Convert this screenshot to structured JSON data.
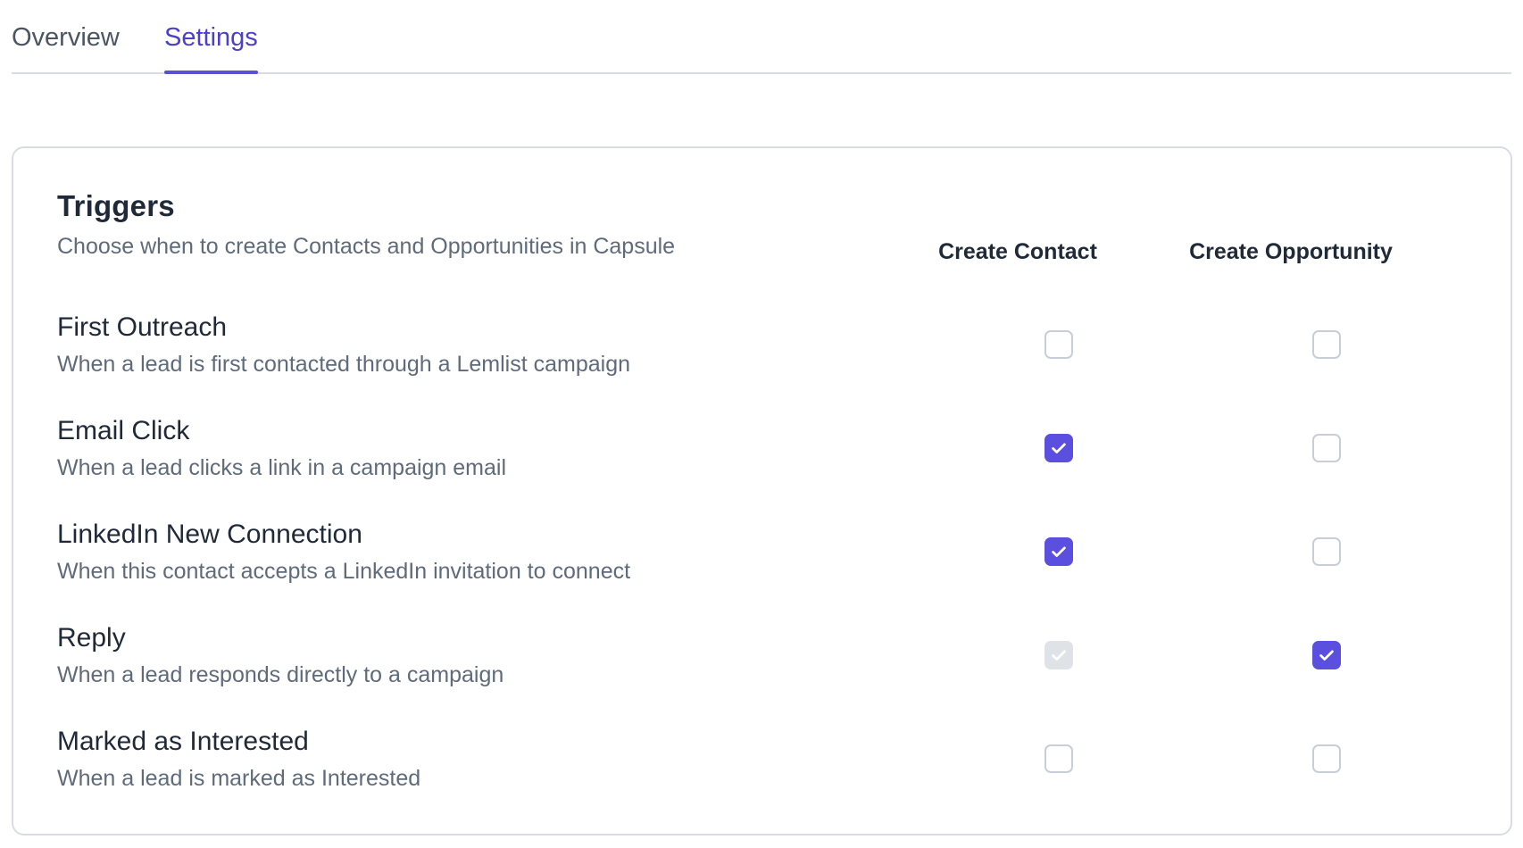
{
  "tabs": [
    {
      "label": "Overview",
      "active": false
    },
    {
      "label": "Settings",
      "active": true
    }
  ],
  "card": {
    "title": "Triggers",
    "subtitle": "Choose when to create Contacts and Opportunities in Capsule",
    "columns": {
      "contact": "Create Contact",
      "opportunity": "Create Opportunity"
    }
  },
  "triggers": [
    {
      "title": "First Outreach",
      "description": "When a lead is first contacted through a Lemlist campaign",
      "create_contact": "unchecked",
      "create_opportunity": "unchecked"
    },
    {
      "title": "Email Click",
      "description": "When a lead clicks a link in a campaign email",
      "create_contact": "checked",
      "create_opportunity": "unchecked"
    },
    {
      "title": "LinkedIn New Connection",
      "description": "When this contact accepts a LinkedIn invitation to connect",
      "create_contact": "checked",
      "create_opportunity": "unchecked"
    },
    {
      "title": "Reply",
      "description": "When a lead responds directly to a campaign",
      "create_contact": "disabled-checked",
      "create_opportunity": "checked"
    },
    {
      "title": "Marked as Interested",
      "description": "When a lead is marked as Interested",
      "create_contact": "unchecked",
      "create_opportunity": "unchecked"
    }
  ],
  "colors": {
    "accent": "#5b4fe0",
    "tab_active": "#4c3fc9",
    "muted_text": "#5f6b7a",
    "border": "#d9dde3"
  },
  "icons": {
    "checkbox_mark": "check-icon"
  }
}
